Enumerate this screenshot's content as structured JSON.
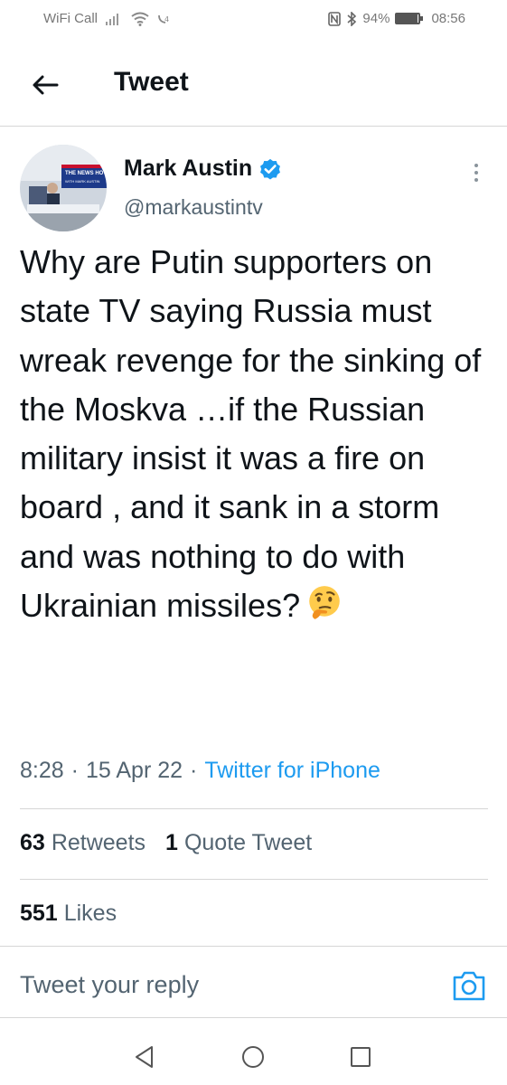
{
  "status_bar": {
    "carrier": "WiFi Call",
    "battery": "94%",
    "battery_level": 0.94,
    "time": "08:56"
  },
  "header": {
    "title": "Tweet",
    "back_icon": "arrow-left-icon"
  },
  "tweet": {
    "author_name": "Mark Austin",
    "author_handle": "@markaustintv",
    "verified": true,
    "avatar_text_line1": "THE NEWS HO",
    "avatar_text_line2": "WITH MARK AUSTIN",
    "text": "Why are Putin supporters on state TV saying Russia must wreak revenge for the sinking of the Moskva …if the Russian military insist it was a fire on board , and it sank in a storm and was nothing to do with Ukrainian missiles?",
    "emoji": "thinking-face",
    "time": "8:28",
    "date": "15 Apr 22",
    "separator": "·",
    "source": "Twitter for iPhone"
  },
  "stats": {
    "retweets_count": "63",
    "retweets_label": "Retweets",
    "quotes_count": "1",
    "quotes_label": "Quote Tweet",
    "likes_count": "551",
    "likes_label": "Likes"
  },
  "reply": {
    "placeholder": "Tweet your reply",
    "camera_icon": "camera-icon"
  },
  "colors": {
    "accent": "#1d9bf0",
    "text": "#0f1419",
    "muted": "#536471",
    "divider": "#d6d6d6"
  }
}
